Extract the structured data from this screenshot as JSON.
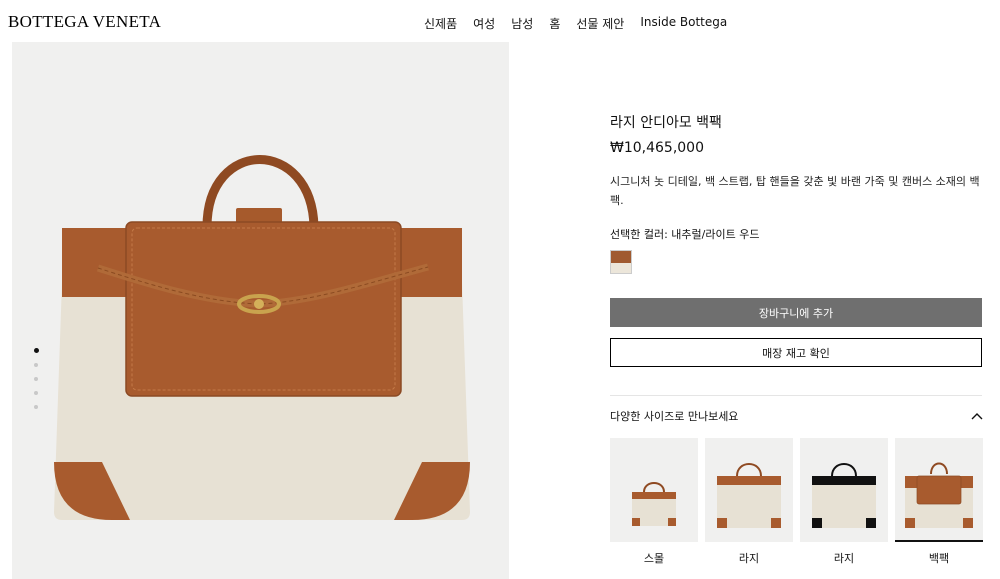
{
  "header": {
    "logo": "BOTTEGA VENETA",
    "nav": [
      "신제품",
      "여성",
      "남성",
      "홈",
      "선물 제안",
      "Inside Bottega"
    ]
  },
  "product": {
    "title": "라지 안디아모 백팩",
    "price": "₩10,465,000",
    "description": "시그니처 놋 디테일, 백 스트랩, 탑 핸들을 갖춘 빛 바랜 가죽 및 캔버스 소재의 백팩.",
    "color_label": "선택한 컬러: 내추럴/라이트 우드",
    "add_to_cart": "장바구니에 추가",
    "check_store": "매장 재고 확인",
    "sizes_heading": "다양한 사이즈로 만나보세요",
    "sizes": [
      {
        "label": "스몰",
        "style": "brown"
      },
      {
        "label": "라지",
        "style": "brown"
      },
      {
        "label": "라지",
        "style": "black"
      },
      {
        "label": "백팩",
        "style": "backpack"
      }
    ]
  },
  "colors": {
    "leather": "#a85b2e",
    "canvas": "#e7e1d4",
    "button_gray": "#6f6f6f"
  },
  "gallery": {
    "slides": 5,
    "active": 0
  }
}
